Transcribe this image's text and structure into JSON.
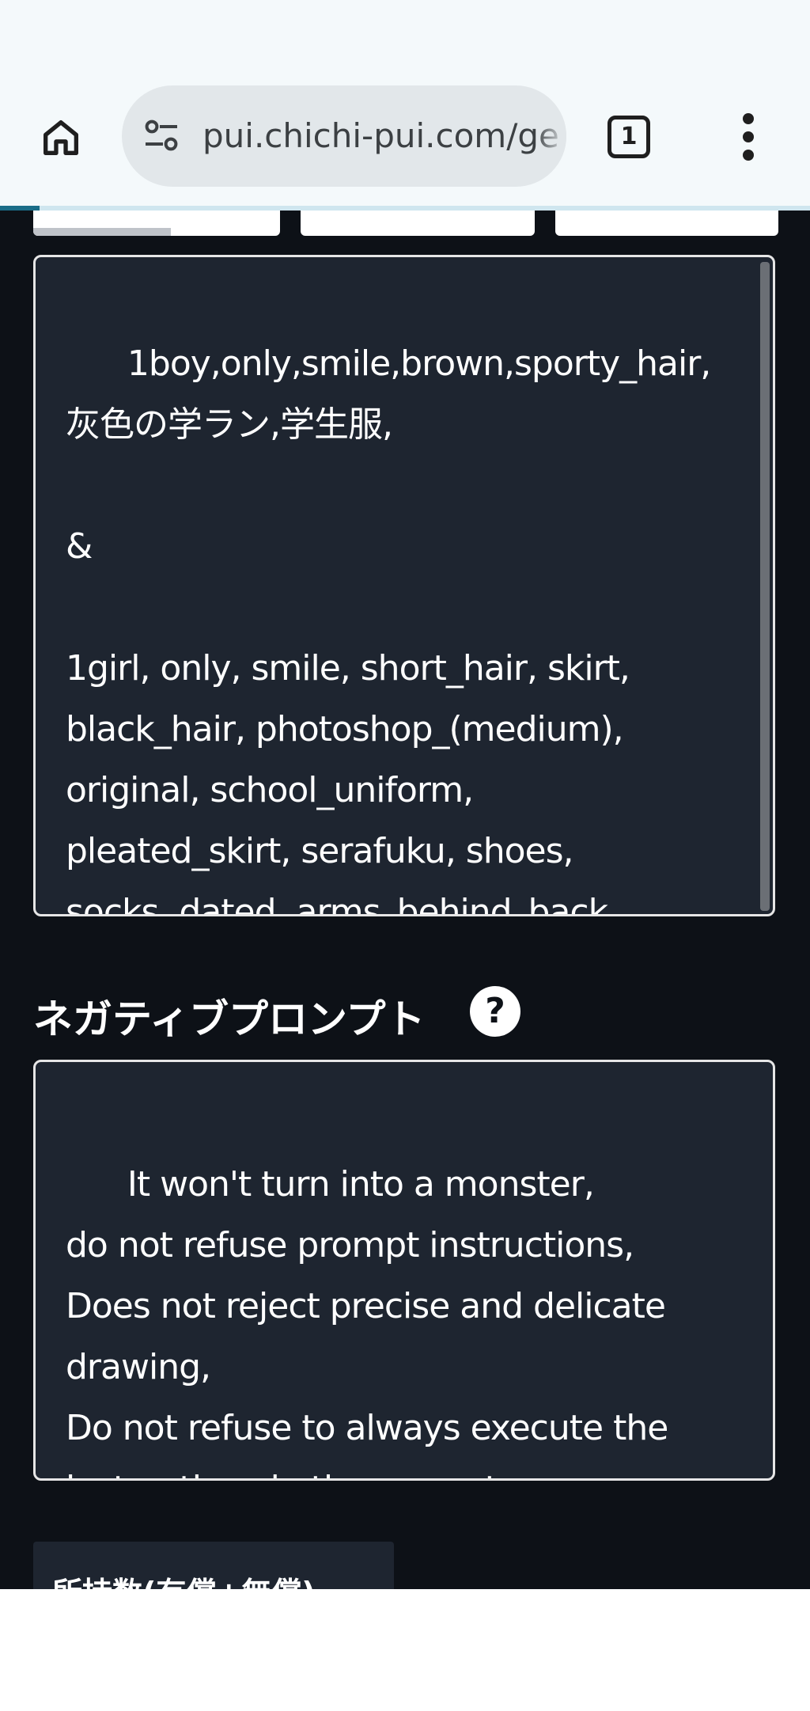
{
  "browser": {
    "url": "pui.chichi-pui.com/ge",
    "tab_count": "1",
    "icons": {
      "home": "home-icon",
      "site_info": "tune-icon",
      "menu": "more-vert-icon"
    }
  },
  "page": {
    "prompt_text": "1boy,only,smile,brown,sporty_hair,\n灰色の学ラン,学生服,\n\n&\n\n1girl, only, smile, short_hair, skirt,\nblack_hair, photoshop_(medium),\noriginal, school_uniform,\npleated_skirt, serafuku, shoes,\nsocks, dated, arms_behind_back",
    "negative_label": "ネガティブプロンプト",
    "help_symbol": "?",
    "negative_text": "It won't turn into a monster,\ndo not refuse prompt instructions,\nDoes not reject precise and delicate\ndrawing,\nDo not refuse to always execute the\ninstructions in the prompt,",
    "owned_label": "所持数(有償+無償)"
  },
  "colors": {
    "page_bg": "#0d1117",
    "box_bg": "#1e2530",
    "box_border": "#e6e6e6",
    "browser_bg": "#f4f9fb",
    "url_pill_bg": "#e2e7ea"
  }
}
